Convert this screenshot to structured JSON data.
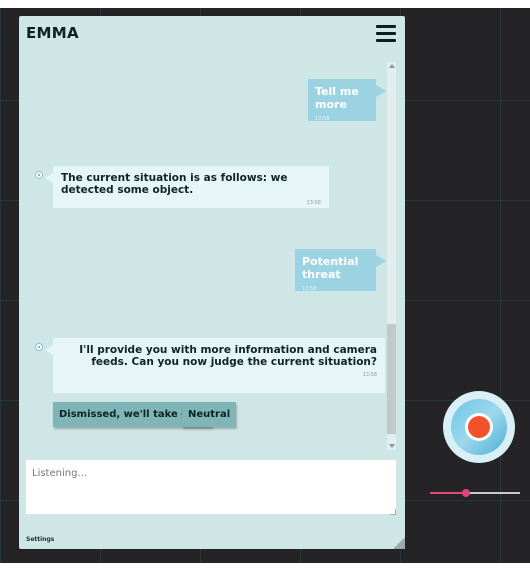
{
  "app": {
    "title": "EMMA"
  },
  "messages": {
    "user_1": {
      "text": "Tell me more",
      "time": "13:58"
    },
    "bot_1": {
      "text": "The current situation is as follows: we detected some object.",
      "time": "13:58"
    },
    "user_2": {
      "text": "Potential threat",
      "time": "13:58"
    },
    "bot_2": {
      "text": "I'll provide you with more information and camera feeds. Can you now judge the current situation?",
      "time": "13:58"
    }
  },
  "quick_replies": [
    "Dismissed, we'll take over",
    "Neutral"
  ],
  "input": {
    "placeholder": "Listening..."
  },
  "footer": {
    "settings_label": "Settings"
  },
  "controls": {
    "volume_level": 0.4
  },
  "colors": {
    "panel_bg": "#cfe6e6",
    "user_bubble": "#9bd3e3",
    "bot_bubble": "#e6f6f7",
    "quick_reply": "#7fb5b6",
    "record_dot": "#f2522a",
    "slider_accent": "#e0457a"
  },
  "icons": {
    "menu": "hamburger-icon",
    "record": "record-icon",
    "bot": "bot-avatar-icon"
  }
}
